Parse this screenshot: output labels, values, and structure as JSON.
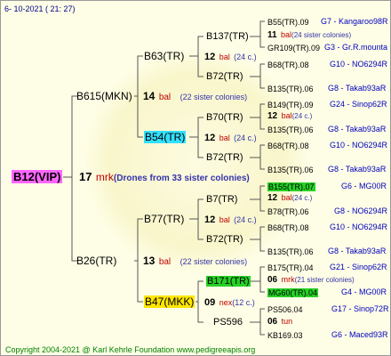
{
  "header": {
    "date": "6-  10-2021  (  21:  27)"
  },
  "footer": {
    "copyright": "Copyright 2004-2021 @ Karl Kehrle Foundation    www.pedigreeapis.org"
  },
  "root": {
    "name": "B12(VIP)",
    "num": "17",
    "mark": "mrk",
    "comment": "(Drones from 33 sister colonies)"
  },
  "g1": [
    {
      "name": "B615(MKN)",
      "num": "14",
      "mark": "bal",
      "comment": "(22 sister colonies)"
    },
    {
      "name": "B26(TR)",
      "num": "13",
      "mark": "bal",
      "comment": "(22 sister colonies)"
    }
  ],
  "g2": [
    {
      "name": "B63(TR)",
      "num": "12",
      "mark": "bal",
      "comment": "(24 c.)"
    },
    {
      "name": "B54(TR)",
      "num": "12",
      "mark": "bal",
      "comment": "(24 c.)"
    },
    {
      "name": "B77(TR)",
      "num": "12",
      "mark": "bal",
      "comment": "(24 c.)"
    },
    {
      "name": "B47(MKK)",
      "num": "09",
      "mark": "nex",
      "comment": "(12 c.)"
    }
  ],
  "g3": [
    {
      "name": "B137(TR)",
      "num": "11",
      "mark": "bal",
      "comment": "(24 sister colonies)"
    },
    {
      "name": "B72(TR)"
    },
    {
      "name": "B70(TR)",
      "num": "12",
      "mark": "bal",
      "comment": "(24 c.)"
    },
    {
      "name": "B72(TR)"
    },
    {
      "name": "B7(TR)",
      "num": "12",
      "mark": "bal",
      "comment": "(24 c.)"
    },
    {
      "name": "B72(TR)"
    },
    {
      "name": "B171(TR)",
      "num": "06",
      "mark": "mrk",
      "comment": "(21 sister colonies)"
    },
    {
      "name": "PS596",
      "num": "06",
      "mark": "tun"
    }
  ],
  "g4": [
    {
      "name": "B55(TR).09",
      "ref": "G7 - Kangaroo98R"
    },
    {
      "name": "GR109(TR).09",
      "ref": "G3 - Gr.R.mounta"
    },
    {
      "name": "B68(TR).08",
      "ref": "G10 - NO6294R"
    },
    {
      "name": "B135(TR).06",
      "ref": "G8 - Takab93aR"
    },
    {
      "name": "B149(TR).09",
      "ref": "G24 - Sinop62R"
    },
    {
      "name": "B135(TR).06",
      "ref": "G8 - Takab93aR"
    },
    {
      "name": "B68(TR).08",
      "ref": "G10 - NO6294R"
    },
    {
      "name": "B135(TR).06",
      "ref": "G8 - Takab93aR"
    },
    {
      "name": "B155(TR).07",
      "ref": "G6 - MG00R"
    },
    {
      "name": "B78(TR).06",
      "ref": "G8 - NO6294R"
    },
    {
      "name": "B68(TR).08",
      "ref": "G10 - NO6294R"
    },
    {
      "name": "B135(TR).06",
      "ref": "G8 - Takab93aR"
    },
    {
      "name": "B175(TR).04",
      "ref": "G21 - Sinop62R"
    },
    {
      "name": "MG60(TR).04",
      "ref": "G4 - MG00R"
    },
    {
      "name": "PS506.04",
      "ref": "G17 - Sinop72R"
    },
    {
      "name": "KB169.03",
      "ref": "G6 - Maced93R"
    }
  ],
  "colors": {
    "hl_yellow": "#ffe600",
    "hl_cyan": "#33e0ff",
    "hl_green": "#26d126",
    "hl_magenta": "#ff66ff",
    "mark_red": "#c00000",
    "comment_blue": "#3333aa",
    "ref_blue": "#0000c0",
    "header_blue": "#00008b",
    "footer_green": "#008000"
  }
}
